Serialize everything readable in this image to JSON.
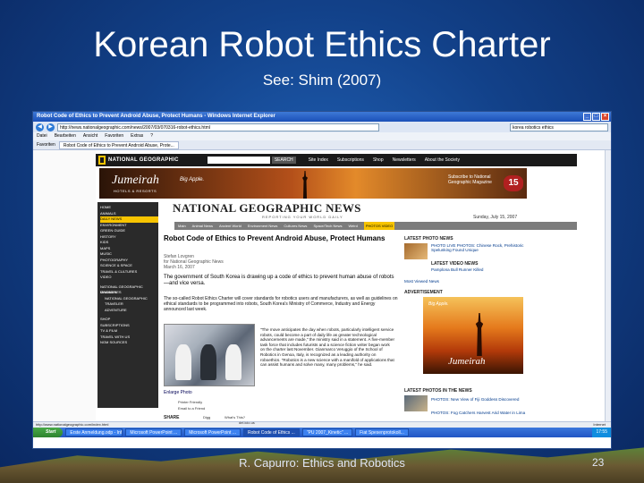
{
  "slide": {
    "title": "Korean Robot Ethics Charter",
    "subtitle": "See: Shim (2007)",
    "footer": "R. Capurro: Ethics and Robotics",
    "page_number": "23"
  },
  "browser": {
    "window_title": "Robot Code of Ethics to Prevent Android Abuse, Protect Humans - Windows Internet Explorer",
    "address": "http://news.nationalgeographic.com/news/2007/03/070316-robot-ethics.html",
    "search_value": "korea robotics ethics",
    "menu": [
      "Datei",
      "Bearbeiten",
      "Ansicht",
      "Favoriten",
      "Extras",
      "?"
    ],
    "tab_label": "Robot Code of Ethics to Prevent Android Abuse, Prote...",
    "favorites_label": "Favoriten",
    "status_text": "http://www.nationalgeographic.com/index.html",
    "status_zone": "Internet"
  },
  "ng": {
    "logo": "NATIONAL GEOGRAPHIC",
    "search_button": "SEARCH",
    "nav": [
      "Site Index",
      "Subscriptions",
      "Shop",
      "Newsletters",
      "About the Society"
    ],
    "ad_brand": "Jumeirah",
    "ad_brand_sub": "HOTELS & RESORTS",
    "ad_tagline": "Big Apple.",
    "ad_subscribe": "Subscribe to National Geographic Magazine",
    "ad_badge": "15"
  },
  "leftnav": {
    "items": [
      "Home",
      "Animals",
      "Daily News",
      "Environment",
      "Green Guide",
      "History",
      "Kids",
      "Maps",
      "Music",
      "Photography",
      "Science & Space",
      "Travel & Cultures",
      "Video"
    ],
    "items2": [
      "National Geographic Channel",
      "Magazines"
    ],
    "indented": [
      "National Geographic",
      "Traveler",
      "Adventure"
    ],
    "items3": [
      "Shop",
      "Subscriptions",
      "TV & Film",
      "Travel with Us",
      "NGM Sources"
    ]
  },
  "news": {
    "masthead": "NATIONAL GEOGRAPHIC NEWS",
    "masthead_sub": "REPORTING YOUR WORLD DAILY",
    "date": "Sunday, July 15, 2007",
    "nav": [
      "Main",
      "Animal News",
      "Ancient World",
      "Environment News",
      "Cultures News",
      "Space/Tech News",
      "Weird"
    ],
    "nav_highlight": "PHOTOS   VIDEO",
    "headline": "Robot Code of Ethics to Prevent Android Abuse, Protect Humans",
    "byline": "Stefan Lovgren\nfor National Geographic News\nMarch 16, 2007",
    "lede": "The government of South Korea is drawing up a code of ethics to prevent human abuse of robots—and vice versa.",
    "body": "The so-called Robot Ethics Charter will cover standards for robotics users and manufacturers, as well as guidelines on ethical standards to be programmed into robots, South Korea's Ministry of Commerce, Industry and Energy announced last week.",
    "quote": "\"The move anticipates the day when robots, particularly intelligent service robots, could become a part of daily life as greater technological advancements are made,\" the ministry said in a statement. A five-member task force that includes futurists and a science fiction writer began work on the charter last November. Gianmarco Veruggio of the School of Robotics in Genoa, Italy, is recognized as a leading authority on roboethics. \"Robotics is a new science with a manifold of applications that can assist humans and solve many, many problems,\" he said.",
    "enlarge": "Enlarge Photo",
    "print": "Printer Friendly",
    "email": "Email to a Friend",
    "share": "SHARE",
    "whats_this": "What's This?",
    "digg": "Digg",
    "delicious": "del.icio.us"
  },
  "right": {
    "latest_photo_news": "LATEST PHOTO NEWS",
    "photo_item": "PHOTO LIVE PHOTOS: Chinese Rock, Prehistoric Spelunking Found Unique",
    "latest_video": "LATEST VIDEO NEWS",
    "video_item": "Pamplona Bull Runner Killed",
    "most_viewed": "Most Viewed News",
    "advertisement": "ADVERTISEMENT",
    "ad_tag": "Big Apple.",
    "ad_brand": "Jumeirah",
    "latest_in_news": "LATEST PHOTOS IN THE NEWS",
    "news_item1": "PHOTOS: New View of Fiji Goddess Discovered",
    "news_item2": "PHOTOS: Fog Catchers Harvest Arid Water in Lima"
  },
  "taskbar": {
    "start": "Start",
    "buttons": [
      "Erste Anmeldung.odp - Info...",
      "Microsoft PowerPoint ...",
      "Microsoft PowerPoint ...",
      "Robot Code of Ethics ...",
      "\"PU 2007_Kinetic\" ...",
      "Fiat Spesenprotokoll..."
    ],
    "active_index": 3,
    "tray": "17:55"
  }
}
